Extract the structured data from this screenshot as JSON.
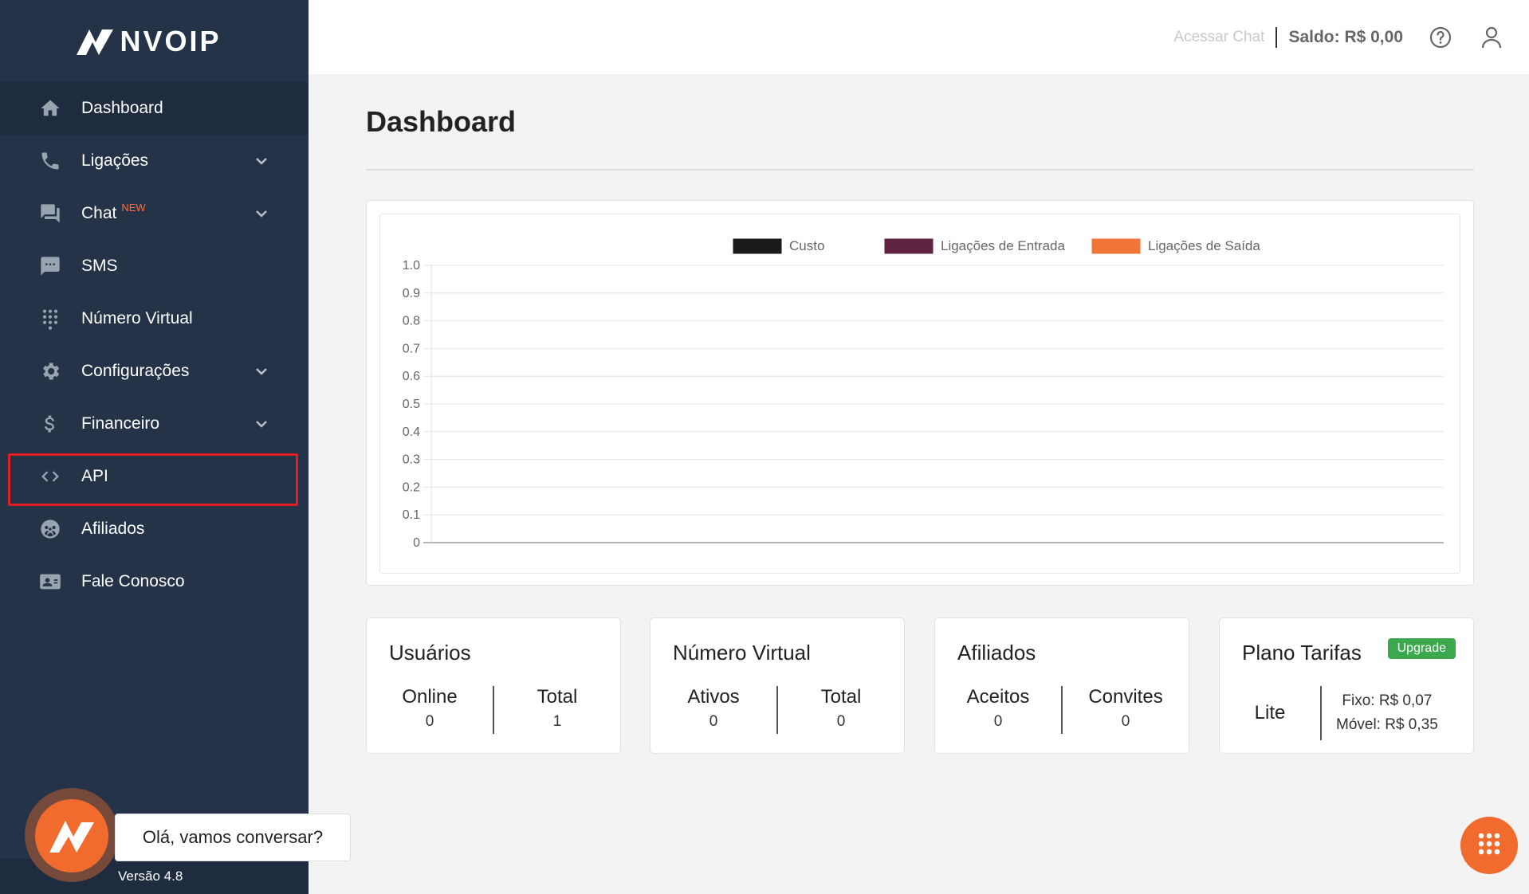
{
  "brand": {
    "name": "NVOIP"
  },
  "sidebar": {
    "items": [
      {
        "label": "Dashboard",
        "icon": "home-icon"
      },
      {
        "label": "Ligações",
        "icon": "phone-icon"
      },
      {
        "label": "Chat",
        "icon": "chat-icon",
        "badge": "NEW"
      },
      {
        "label": "SMS",
        "icon": "sms-icon"
      },
      {
        "label": "Número Virtual",
        "icon": "dialpad-icon"
      },
      {
        "label": "Configurações",
        "icon": "gear-icon"
      },
      {
        "label": "Financeiro",
        "icon": "dollar-icon"
      },
      {
        "label": "API",
        "icon": "code-icon"
      },
      {
        "label": "Afiliados",
        "icon": "affiliates-icon"
      },
      {
        "label": "Fale Conosco",
        "icon": "contact-card-icon"
      }
    ],
    "version": "Versão 4.8"
  },
  "topbar": {
    "chat_link": "Acessar Chat",
    "saldo": "Saldo: R$ 0,00"
  },
  "page": {
    "title": "Dashboard"
  },
  "chart_data": {
    "type": "line",
    "title": "",
    "xlabel": "",
    "ylabel": "",
    "ylim": [
      0,
      1.0
    ],
    "yticks": [
      "1.0",
      "0.9",
      "0.8",
      "0.7",
      "0.6",
      "0.5",
      "0.4",
      "0.3",
      "0.2",
      "0.1",
      "0"
    ],
    "grid": true,
    "legend_position": "top",
    "series": [
      {
        "name": "Custo",
        "color": "#1a1a1a",
        "values": []
      },
      {
        "name": "Ligações de Entrada",
        "color": "#5e2340",
        "values": []
      },
      {
        "name": "Ligações de Saída",
        "color": "#f07536",
        "values": []
      }
    ]
  },
  "cards": {
    "usuarios": {
      "title": "Usuários",
      "cols": [
        {
          "label": "Online",
          "value": "0"
        },
        {
          "label": "Total",
          "value": "1"
        }
      ]
    },
    "numero_virtual": {
      "title": "Número Virtual",
      "cols": [
        {
          "label": "Ativos",
          "value": "0"
        },
        {
          "label": "Total",
          "value": "0"
        }
      ]
    },
    "afiliados": {
      "title": "Afiliados",
      "cols": [
        {
          "label": "Aceitos",
          "value": "0"
        },
        {
          "label": "Convites",
          "value": "0"
        }
      ]
    },
    "plano": {
      "title": "Plano Tarifas",
      "badge": "Upgrade",
      "plan": "Lite",
      "fixo": "Fixo: R$ 0,07",
      "movel": "Móvel: R$ 0,35"
    }
  },
  "chat_widget": {
    "greeting": "Olá, vamos conversar?"
  },
  "colors": {
    "sidebar": "#253349",
    "accent": "#f26b2e",
    "highlight": "#e01e23",
    "success": "#3ba84e"
  }
}
